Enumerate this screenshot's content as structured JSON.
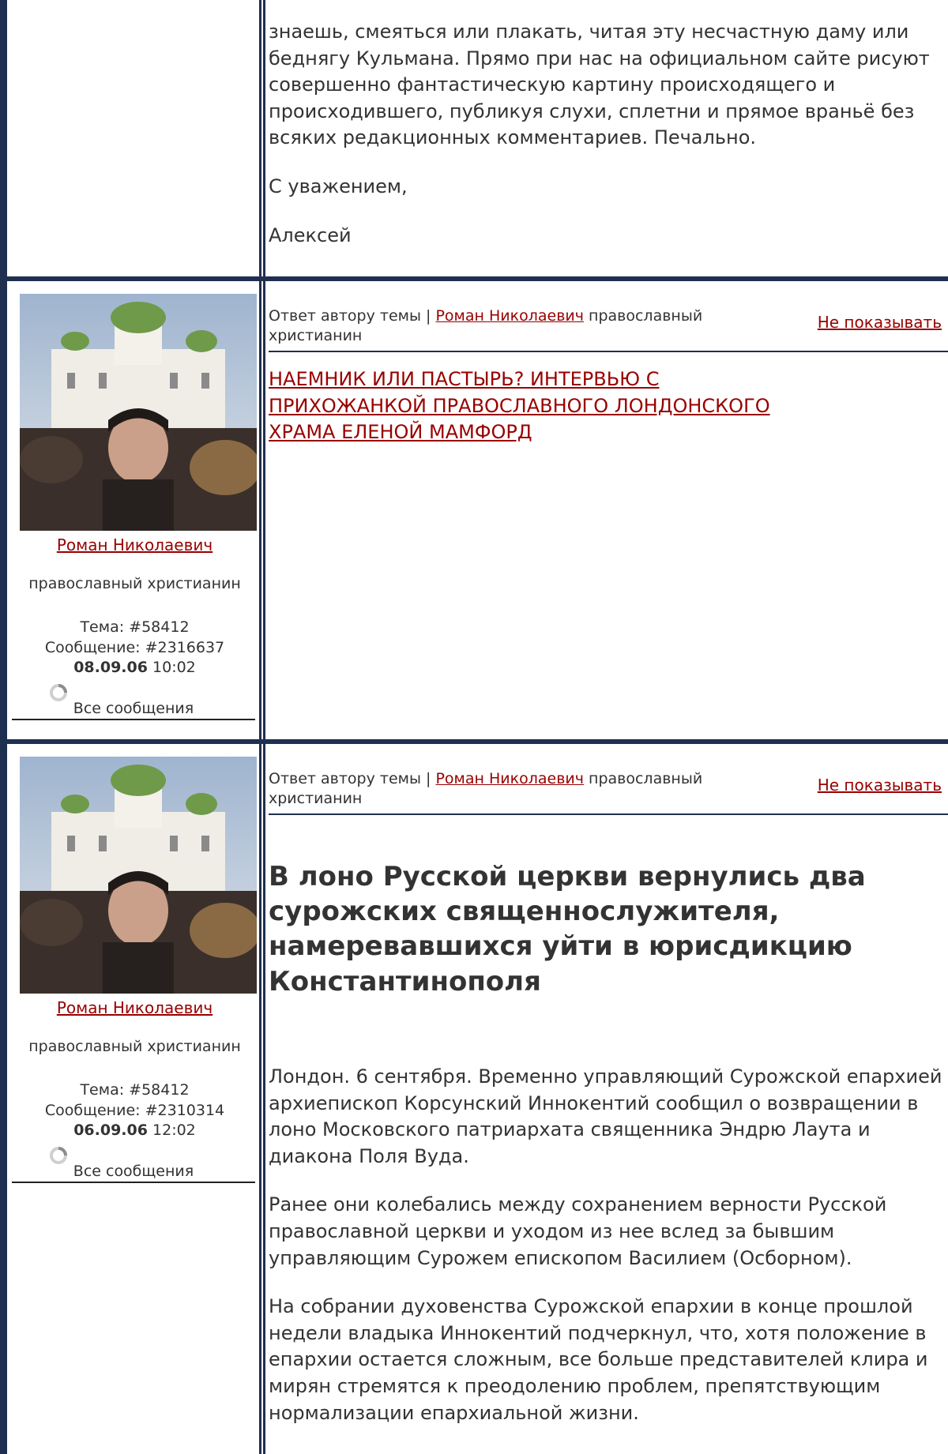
{
  "post1": {
    "text_lines": [
      "знаешь, смеяться или плакать, читая эту несчастную даму или беднягу Кульмана. Прямо при нас на официальном сайте рисуют совершенно фантастическую картину происходящего и происходившего, публикуя слухи, сплетни и прямое враньё без всяких редакционных комментариев. Печально.",
      "С уважением,",
      "Алексей"
    ]
  },
  "post2": {
    "author_name": "Роман Николаевич",
    "author_status": "православный христианин",
    "topic": "Тема: #58412",
    "message": "Сообщение: #2316637",
    "date": "08.09.06",
    "time": "10:02",
    "all_messages": "Все сообщения",
    "reply_prefix": "Ответ автору темы | ",
    "reply_author": "Роман Николаевич",
    "reply_status": " православный христианин",
    "hide_label": "Не показывать",
    "link_text": "НАЕМНИК ИЛИ ПАСТЫРЬ? ИНТЕРВЬЮ С ПРИХОЖАНКОЙ ПРАВОСЛАВНОГО ЛОНДОНСКОГО ХРАМА ЕЛЕНОЙ МАМФОРД"
  },
  "post3": {
    "author_name": "Роман Николаевич",
    "author_status": "православный христианин",
    "topic": "Тема: #58412",
    "message": "Сообщение: #2310314",
    "date": "06.09.06",
    "time": "12:02",
    "all_messages": "Все сообщения",
    "reply_prefix": "Ответ автору темы | ",
    "reply_author": "Роман Николаевич",
    "reply_status": " православный христианин",
    "hide_label": "Не показывать",
    "headline": "В лоно Русской церкви вернулись два сурожских священнослужителя, намеревавшихся уйти в юрисдикцию Константинополя",
    "paragraphs": [
      "Лондон. 6 сентября. Временно управляющий Сурожской епархией архиепископ Корсунский Иннокентий сообщил о возвращении в лоно Московского патриархата священника Эндрю Лаута и диакона Поля Вуда.",
      "Ранее они колебались между сохранением верности Русской православной церкви и уходом из нее вслед за бывшим управляющим Сурожем епископом Василием (Осборном).",
      "На собрании духовенства Сурожской епархии в конце прошлой недели владыка Иннокентий подчеркнул, что, хотя положение в епархии остается сложным, все больше представителей клира и мирян стремятся к преодолению проблем, препятствующим нормализации епархиальной жизни."
    ]
  }
}
